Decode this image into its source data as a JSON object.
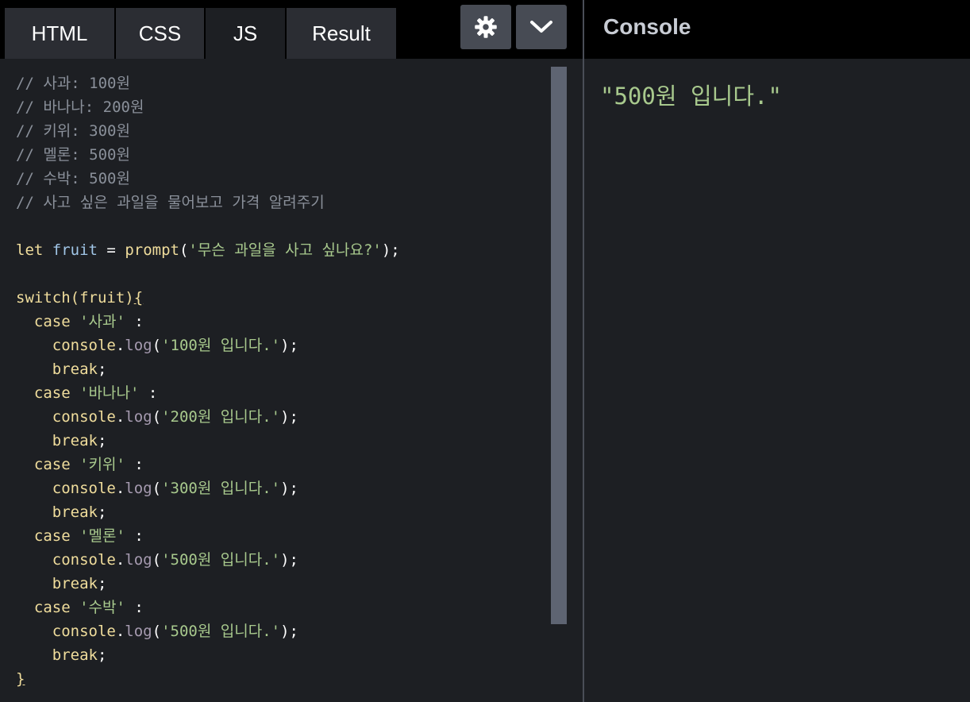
{
  "tabs": {
    "html": "HTML",
    "css": "CSS",
    "js": "JS",
    "result": "Result"
  },
  "toolbar": {
    "settings_icon": "gear-icon",
    "collapse_icon": "chevron-down-icon"
  },
  "code": {
    "comment1": "// 사과: 100원",
    "comment2": "// 바나나: 200원",
    "comment3": "// 키위: 300원",
    "comment4": "// 멜론: 500원",
    "comment5": "// 수박: 500원",
    "comment6": "// 사고 싶은 과일을 물어보고 가격 알려주기",
    "let_kw": "let",
    "var_fruit": "fruit",
    "eq": " = ",
    "prompt_fn": "prompt",
    "prompt_open": "(",
    "prompt_str": "'무슨 과일을 사고 싶나요?'",
    "prompt_close": ");",
    "switch_kw": "switch",
    "switch_arg": "(fruit)",
    "open_brace": "{",
    "case_kw": "case",
    "colon": " :",
    "console_obj": "console",
    "dot": ".",
    "log_method": "log",
    "paren_open": "(",
    "paren_close": ");",
    "break_kw": "break",
    "semicolon": ";",
    "close_brace": "}",
    "cases": [
      {
        "label": "'사과'",
        "message": "'100원 입니다.'"
      },
      {
        "label": "'바나나'",
        "message": "'200원 입니다.'"
      },
      {
        "label": "'키위'",
        "message": "'300원 입니다.'"
      },
      {
        "label": "'멜론'",
        "message": "'500원 입니다.'"
      },
      {
        "label": "'수박'",
        "message": "'500원 입니다.'"
      }
    ]
  },
  "console": {
    "title": "Console",
    "output": "\"500원 입니다.\""
  },
  "colors": {
    "comment": "#8a909a",
    "keyword": "#f0dd9c",
    "string": "#a8c98d",
    "variable": "#a1c6e7",
    "method": "#a69bb0",
    "background": "#1d1f23"
  }
}
